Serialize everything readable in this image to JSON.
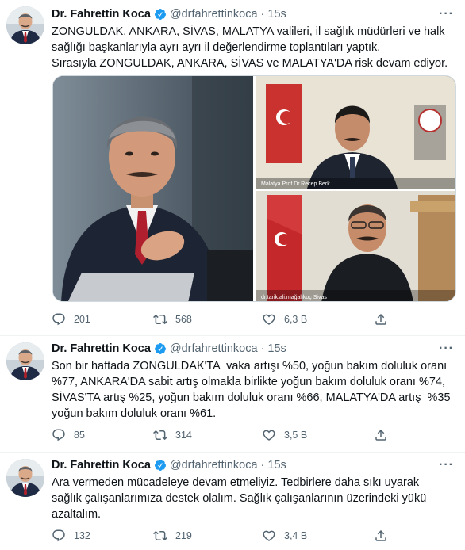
{
  "tweets": [
    {
      "author_name": "Dr. Fahrettin Koca",
      "handle": "@drfahrettinkoca",
      "separator": "·",
      "time": "15s",
      "text_lines": [
        "ZONGULDAK, ANKARA, SİVAS, MALATYA valileri, il sağlık müdürleri ve halk",
        "sağlığı başkanlarıyla ayrı ayrı il değerlendirme toplantıları yaptık.",
        "Sırasıyla ZONGULDAK, ANKARA, SİVAS ve MALATYA'DA risk devam ediyor."
      ],
      "media": {
        "caption_top": "Malatya Prof.Dr.Recep Berk",
        "caption_bottom": "dr.tarik.ali.mağalıkoç Sivas"
      },
      "replies": "201",
      "retweets": "568",
      "likes": "6,3 B"
    },
    {
      "author_name": "Dr. Fahrettin Koca",
      "handle": "@drfahrettinkoca",
      "separator": "·",
      "time": "15s",
      "text_lines": [
        "Son bir haftada ZONGULDAK'TA  vaka artışı %50, yoğun bakım doluluk oranı",
        "%77, ANKARA'DA sabit artış olmakla birlikte yoğun bakım doluluk oranı %74,",
        "SİVAS'TA artış %25, yoğun bakım doluluk oranı %66, MALATYA'DA artış  %35",
        "yoğun bakım doluluk oranı %61."
      ],
      "replies": "85",
      "retweets": "314",
      "likes": "3,5 B"
    },
    {
      "author_name": "Dr. Fahrettin Koca",
      "handle": "@drfahrettinkoca",
      "separator": "·",
      "time": "15s",
      "text_lines": [
        "Ara vermeden mücadeleye devam etmeliyiz. Tedbirlere daha sıkı uyarak",
        "sağlık çalışanlarımıza destek olalım. Sağlık çalışanlarının üzerindeki yükü",
        "azaltalım."
      ],
      "replies": "132",
      "retweets": "219",
      "likes": "3,4 B"
    }
  ],
  "colors": {
    "text": "#0f1419",
    "muted": "#536471",
    "verified": "#1d9bf0",
    "border": "#eff3f4"
  }
}
